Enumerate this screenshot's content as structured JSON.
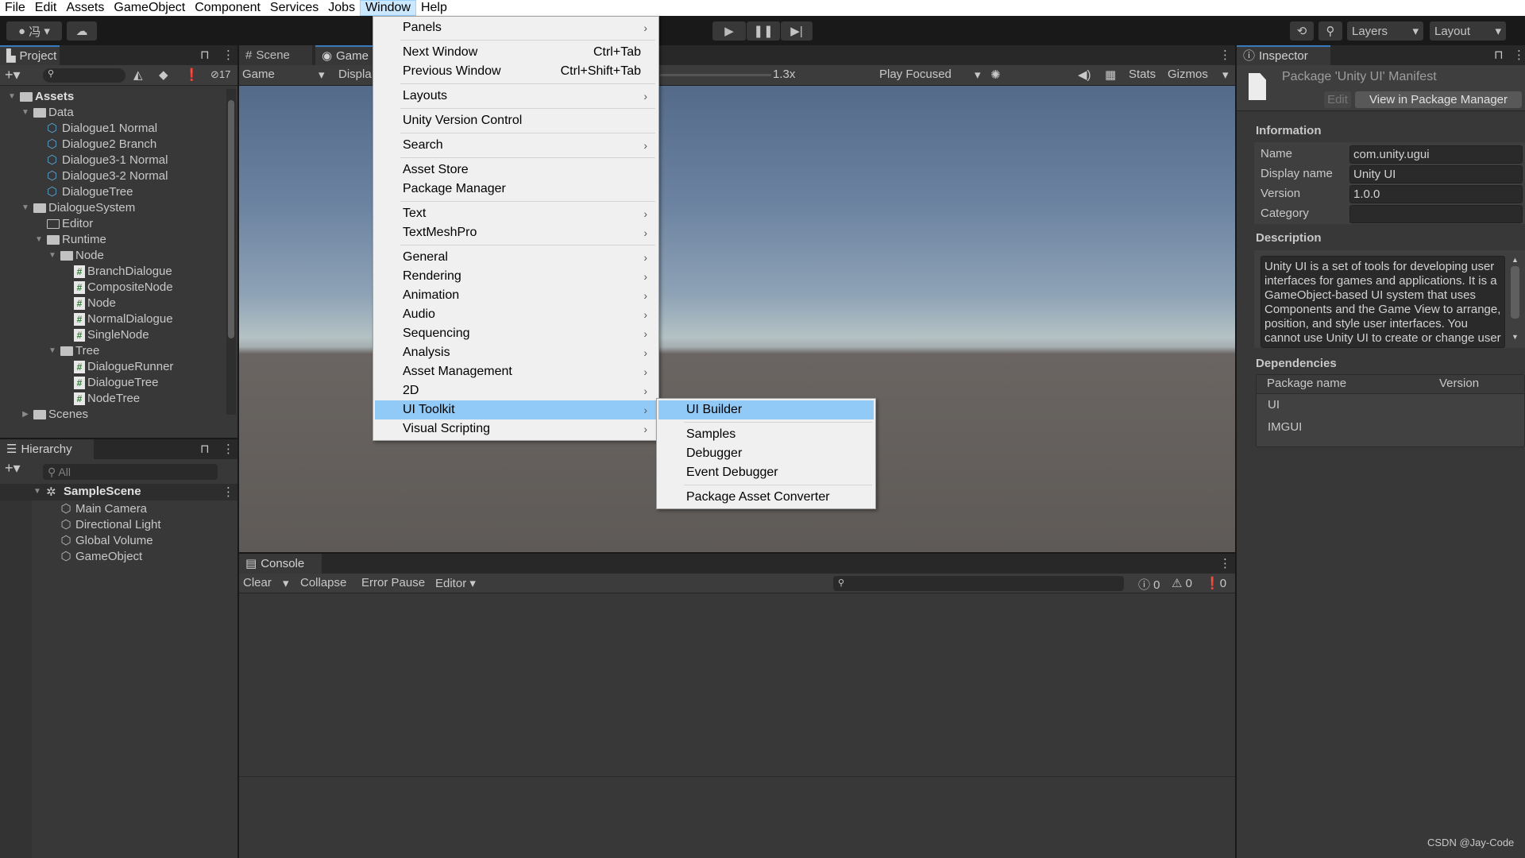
{
  "menubar": [
    "File",
    "Edit",
    "Assets",
    "GameObject",
    "Component",
    "Services",
    "Jobs",
    "Window",
    "Help"
  ],
  "toolbar": {
    "account_label": "冯",
    "layers": "Layers",
    "layout": "Layout"
  },
  "project": {
    "tab": "Project",
    "hidden_count": "17",
    "tree": [
      {
        "label": "Assets",
        "depth": 0,
        "icon": "folder-open",
        "expanded": true,
        "bold": true
      },
      {
        "label": "Data",
        "depth": 1,
        "icon": "folder-open",
        "expanded": true
      },
      {
        "label": "Dialogue1 Normal",
        "depth": 2,
        "icon": "scriptable-object"
      },
      {
        "label": "Dialogue2 Branch",
        "depth": 2,
        "icon": "scriptable-object"
      },
      {
        "label": "Dialogue3-1 Normal",
        "depth": 2,
        "icon": "scriptable-object"
      },
      {
        "label": "Dialogue3-2 Normal",
        "depth": 2,
        "icon": "scriptable-object"
      },
      {
        "label": "DialogueTree",
        "depth": 2,
        "icon": "scriptable-object"
      },
      {
        "label": "DialogueSystem",
        "depth": 1,
        "icon": "folder-open",
        "expanded": true
      },
      {
        "label": "Editor",
        "depth": 2,
        "icon": "folder-empty"
      },
      {
        "label": "Runtime",
        "depth": 2,
        "icon": "folder-open",
        "expanded": true
      },
      {
        "label": "Node",
        "depth": 3,
        "icon": "folder-open",
        "expanded": true
      },
      {
        "label": "BranchDialogue",
        "depth": 4,
        "icon": "cs-script"
      },
      {
        "label": "CompositeNode",
        "depth": 4,
        "icon": "cs-script"
      },
      {
        "label": "Node",
        "depth": 4,
        "icon": "cs-script"
      },
      {
        "label": "NormalDialogue",
        "depth": 4,
        "icon": "cs-script"
      },
      {
        "label": "SingleNode",
        "depth": 4,
        "icon": "cs-script"
      },
      {
        "label": "Tree",
        "depth": 3,
        "icon": "folder-open",
        "expanded": true
      },
      {
        "label": "DialogueRunner",
        "depth": 4,
        "icon": "cs-script"
      },
      {
        "label": "DialogueTree",
        "depth": 4,
        "icon": "cs-script"
      },
      {
        "label": "NodeTree",
        "depth": 4,
        "icon": "cs-script"
      },
      {
        "label": "Scenes",
        "depth": 1,
        "icon": "folder",
        "expanded": false
      }
    ]
  },
  "hierarchy": {
    "tab": "Hierarchy",
    "search_placeholder": "All",
    "scene": "SampleScene",
    "items": [
      "Main Camera",
      "Directional Light",
      "Global Volume",
      "GameObject"
    ]
  },
  "game": {
    "tabs": [
      "Scene",
      "Game"
    ],
    "display_select": "Game",
    "display_label": "Displa",
    "scale": "1.3x",
    "play_mode": "Play Focused",
    "stats": "Stats",
    "gizmos": "Gizmos"
  },
  "console": {
    "tab": "Console",
    "clear": "Clear",
    "collapse": "Collapse",
    "error_pause": "Error Pause",
    "editor": "Editor",
    "counts": {
      "info": "0",
      "warn": "0",
      "error": "0"
    }
  },
  "inspector": {
    "tab": "Inspector",
    "title": "Package 'Unity UI' Manifest",
    "edit": "Edit",
    "view_pm": "View in Package Manager",
    "info_header": "Information",
    "fields": [
      {
        "label": "Name",
        "value": "com.unity.ugui"
      },
      {
        "label": "Display name",
        "value": "Unity UI"
      },
      {
        "label": "Version",
        "value": "1.0.0"
      },
      {
        "label": "Category",
        "value": ""
      }
    ],
    "desc_header": "Description",
    "description": "Unity UI is a set of tools for developing user interfaces for games and applications. It is a GameObject-based UI system that uses Components and the Game View to arrange, position, and style user interfaces.  You cannot use Unity UI to create or change user interfaces in the",
    "deps_header": "Dependencies",
    "deps_cols": [
      "Package name",
      "Version"
    ],
    "deps": [
      "UI",
      "IMGUI"
    ]
  },
  "window_menu": [
    {
      "label": "Panels",
      "sub": true
    },
    {
      "sep": true
    },
    {
      "label": "Next Window",
      "shortcut": "Ctrl+Tab"
    },
    {
      "label": "Previous Window",
      "shortcut": "Ctrl+Shift+Tab"
    },
    {
      "sep": true
    },
    {
      "label": "Layouts",
      "sub": true
    },
    {
      "sep": true
    },
    {
      "label": "Unity Version Control"
    },
    {
      "sep": true
    },
    {
      "label": "Search",
      "sub": true
    },
    {
      "sep": true
    },
    {
      "label": "Asset Store"
    },
    {
      "label": "Package Manager"
    },
    {
      "sep": true
    },
    {
      "label": "Text",
      "sub": true
    },
    {
      "label": "TextMeshPro",
      "sub": true
    },
    {
      "sep": true
    },
    {
      "label": "General",
      "sub": true
    },
    {
      "label": "Rendering",
      "sub": true
    },
    {
      "label": "Animation",
      "sub": true
    },
    {
      "label": "Audio",
      "sub": true
    },
    {
      "label": "Sequencing",
      "sub": true
    },
    {
      "label": "Analysis",
      "sub": true
    },
    {
      "label": "Asset Management",
      "sub": true
    },
    {
      "label": "2D",
      "sub": true
    },
    {
      "label": "UI Toolkit",
      "sub": true,
      "highlighted": true
    },
    {
      "label": "Visual Scripting",
      "sub": true
    }
  ],
  "ui_toolkit_submenu": [
    {
      "label": "UI Builder",
      "highlighted": true
    },
    {
      "sep": true
    },
    {
      "label": "Samples"
    },
    {
      "label": "Debugger"
    },
    {
      "label": "Event Debugger"
    },
    {
      "sep": true
    },
    {
      "label": "Package Asset Converter"
    }
  ],
  "watermark": "CSDN @Jay-Code",
  "colors": {
    "menu_highlight": "#91c9f7",
    "tab_accent": "#3a79bb",
    "panel_bg": "#383838"
  }
}
